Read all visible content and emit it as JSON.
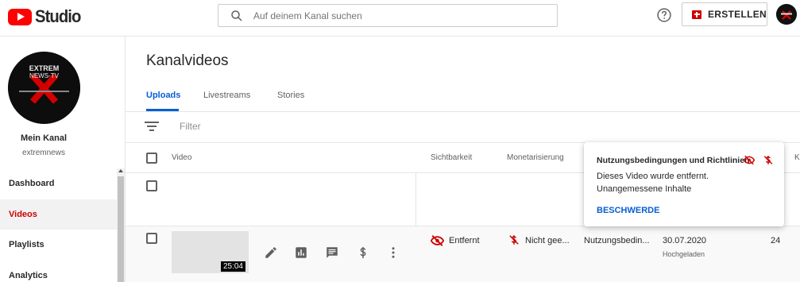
{
  "header": {
    "logo_text": "Studio",
    "search_placeholder": "Auf deinem Kanal suchen",
    "create_label": "ERSTELLEN"
  },
  "channel": {
    "name": "Mein Kanal",
    "handle": "extremnews",
    "avatar_text_line1": "EXTREM",
    "avatar_text_line2": "NEWS-TV"
  },
  "sidebar": {
    "items": [
      {
        "label": "Dashboard"
      },
      {
        "label": "Videos"
      },
      {
        "label": "Playlists"
      },
      {
        "label": "Analytics"
      }
    ]
  },
  "main": {
    "title": "Kanalvideos",
    "tabs": [
      {
        "label": "Uploads"
      },
      {
        "label": "Livestreams"
      },
      {
        "label": "Stories"
      }
    ],
    "filter_placeholder": "Filter"
  },
  "table": {
    "headers": {
      "video": "Video",
      "visibility": "Sichtbarkeit",
      "monetization": "Monetarisierung",
      "extra": "K"
    },
    "row": {
      "duration": "25:04",
      "visibility": "Entfernt",
      "monetization": "Nicht gee...",
      "restrictions": "Nutzungsbedin...",
      "date": "30.07.2020",
      "date_label": "Hochgeladen",
      "count": "24"
    }
  },
  "popup": {
    "title": "Nutzungsbedingungen und Richtlinien",
    "line1": "Dieses Video wurde entfernt.",
    "line2": "Unangemessene Inhalte",
    "action": "BESCHWERDE"
  },
  "colors": {
    "brand_red": "#ff0000",
    "active_red": "#cc0000",
    "link_blue": "#065fd4"
  }
}
